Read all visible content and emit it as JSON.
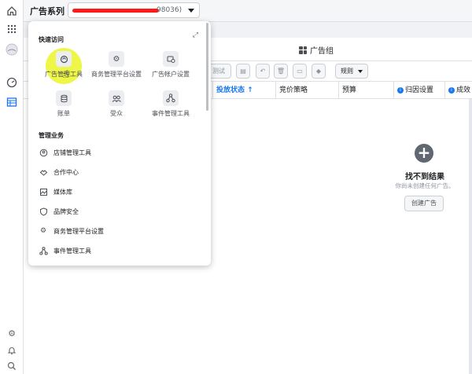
{
  "topbar": {
    "business_title": "广告系列",
    "account_suffix": "98036)"
  },
  "tabs": {
    "adgroup_label": "广告组"
  },
  "toolbar": {
    "test_label": "测试",
    "rules_label": "规则"
  },
  "columns": [
    {
      "label": "投放状态 ↑",
      "sorted": true
    },
    {
      "label": "竞价策略"
    },
    {
      "label": "预算"
    },
    {
      "label": "归因设置",
      "info": true
    },
    {
      "label": "成效",
      "info": true
    }
  ],
  "empty": {
    "title": "找不到结果",
    "subtitle": "你尚未创建任何广告。",
    "button": "创建广告"
  },
  "popup": {
    "quick_access_label": "快速访问",
    "quick_items": [
      {
        "label": "广告管理工具",
        "icon": "ads-manager-icon"
      },
      {
        "label": "商务管理平台设置",
        "icon": "gear-icon"
      },
      {
        "label": "广告帐户设置",
        "icon": "ad-account-settings-icon"
      },
      {
        "label": "账单",
        "icon": "billing-icon"
      },
      {
        "label": "受众",
        "icon": "audience-icon"
      },
      {
        "label": "事件管理工具",
        "icon": "events-manager-icon"
      }
    ],
    "manage_label": "管理业务",
    "manage_items": [
      {
        "label": "店铺管理工具",
        "icon": "shop-icon"
      },
      {
        "label": "合作中心",
        "icon": "partnership-icon"
      },
      {
        "label": "媒体库",
        "icon": "media-library-icon"
      },
      {
        "label": "品牌安全",
        "icon": "shield-icon"
      },
      {
        "label": "商务管理平台设置",
        "icon": "gear-icon"
      },
      {
        "label": "事件管理工具",
        "icon": "events-manager-icon"
      }
    ]
  },
  "colors": {
    "accent": "#1877f2",
    "highlight": "#ebf528",
    "redaction": "#ff1a1a"
  }
}
